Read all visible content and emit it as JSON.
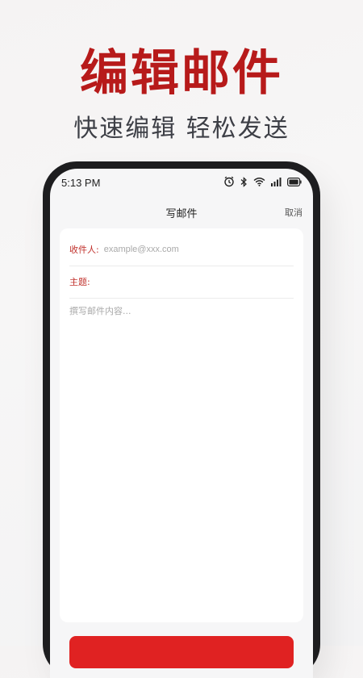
{
  "promo": {
    "headline": "编辑邮件",
    "subheadline": "快速编辑  轻松发送"
  },
  "statusbar": {
    "time": "5:13 PM",
    "icons": [
      "alarm-icon",
      "bluetooth-icon",
      "wifi-icon",
      "signal-icon",
      "battery-icon"
    ]
  },
  "navbar": {
    "title": "写邮件",
    "cancel_label": "取消"
  },
  "compose": {
    "recipient_label": "收件人:",
    "recipient_placeholder": "example@xxx.com",
    "subject_label": "主题:",
    "subject_placeholder": "",
    "body_placeholder": "撰写邮件内容..."
  },
  "colors": {
    "accent": "#b71a1a",
    "button": "#e02222",
    "label": "#c0302b"
  }
}
